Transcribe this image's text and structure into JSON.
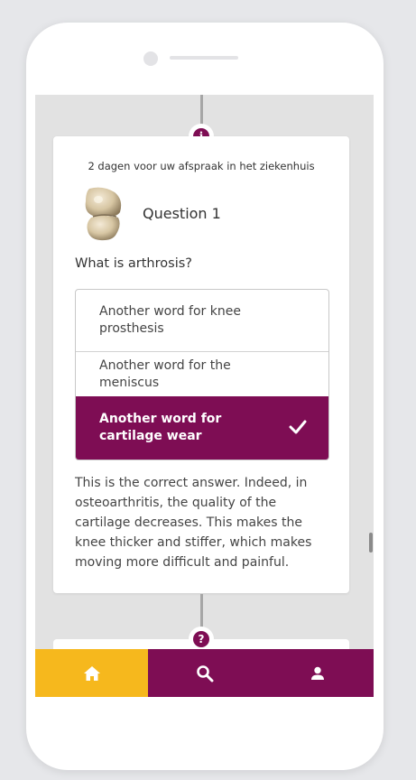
{
  "card": {
    "timing_text": "2 dagen voor uw afspraak in het ziekenhuis",
    "question_title": "Question 1",
    "question_text": "What is arthrosis?",
    "answers": [
      {
        "label": "Another word for knee prosthesis",
        "selected": false
      },
      {
        "label": "Another word for the meniscus",
        "selected": false
      },
      {
        "label": "Another word for cartilage wear",
        "selected": true
      }
    ],
    "explanation": "This is the correct answer. Indeed, in osteoarthritis, the quality of the cartilage decreases. This makes the knee thicker and stiffer, which makes moving more difficult and painful."
  },
  "badges": {
    "info": "i",
    "question": "?"
  },
  "navbar": {
    "items": [
      {
        "icon": "home-icon",
        "active": true
      },
      {
        "icon": "search-icon",
        "active": false
      },
      {
        "icon": "person-icon",
        "active": false
      }
    ]
  },
  "colors": {
    "brand": "#7e0d54",
    "accent": "#f6b81d",
    "background": "#e2e2e2"
  }
}
